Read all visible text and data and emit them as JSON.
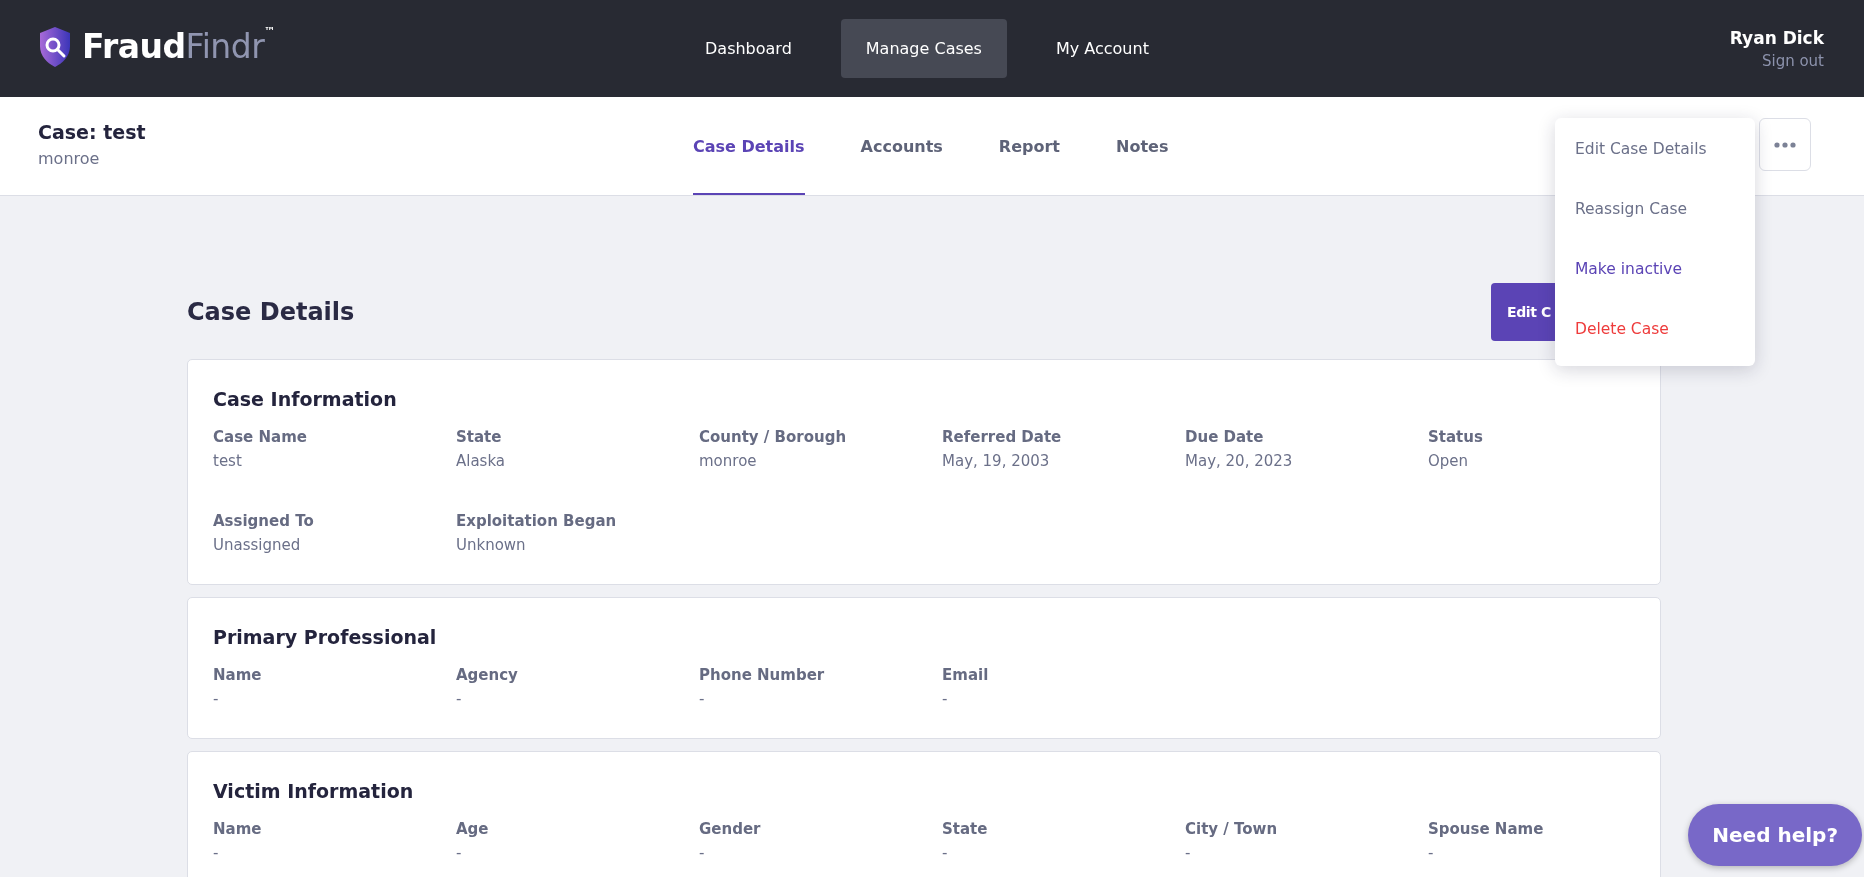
{
  "logo": {
    "bold": "Fraud",
    "light": "Findr",
    "trademark": "™"
  },
  "nav": [
    {
      "label": "Dashboard",
      "selected": false
    },
    {
      "label": "Manage Cases",
      "selected": true
    },
    {
      "label": "My Account",
      "selected": false
    }
  ],
  "user": {
    "name": "Ryan Dick",
    "sign_out": "Sign out"
  },
  "case_header": {
    "title": "Case: test",
    "subtitle": "monroe"
  },
  "tabs": [
    {
      "label": "Case Details",
      "selected": true
    },
    {
      "label": "Accounts",
      "selected": false
    },
    {
      "label": "Report",
      "selected": false
    },
    {
      "label": "Notes",
      "selected": false
    }
  ],
  "more_menu": {
    "expanded": true,
    "items": [
      {
        "label": "Edit Case Details",
        "kind": "normal"
      },
      {
        "label": "Reassign Case",
        "kind": "normal"
      },
      {
        "label": "Make inactive",
        "kind": "primary"
      },
      {
        "label": "Delete Case",
        "kind": "danger"
      }
    ]
  },
  "page": {
    "title": "Case Details",
    "edit_button": "Edit C"
  },
  "sections": [
    {
      "title": "Case Information",
      "fields": [
        {
          "label": "Case Name",
          "value": "test"
        },
        {
          "label": "State",
          "value": "Alaska"
        },
        {
          "label": "County / Borough",
          "value": "monroe"
        },
        {
          "label": "Referred Date",
          "value": "May, 19, 2003"
        },
        {
          "label": "Due Date",
          "value": "May, 20, 2023"
        },
        {
          "label": "Status",
          "value": "Open"
        },
        {
          "label": "Assigned To",
          "value": "Unassigned"
        },
        {
          "label": "Exploitation Began",
          "value": "Unknown"
        }
      ]
    },
    {
      "title": "Primary Professional",
      "fields": [
        {
          "label": "Name",
          "value": "-"
        },
        {
          "label": "Agency",
          "value": "-"
        },
        {
          "label": "Phone Number",
          "value": "-"
        },
        {
          "label": "Email",
          "value": "-"
        }
      ]
    },
    {
      "title": "Victim Information",
      "fields": [
        {
          "label": "Name",
          "value": "-"
        },
        {
          "label": "Age",
          "value": "-"
        },
        {
          "label": "Gender",
          "value": "-"
        },
        {
          "label": "State",
          "value": "-"
        },
        {
          "label": "City / Town",
          "value": "-"
        },
        {
          "label": "Spouse Name",
          "value": "-"
        }
      ]
    }
  ],
  "help_button": "Need help?"
}
